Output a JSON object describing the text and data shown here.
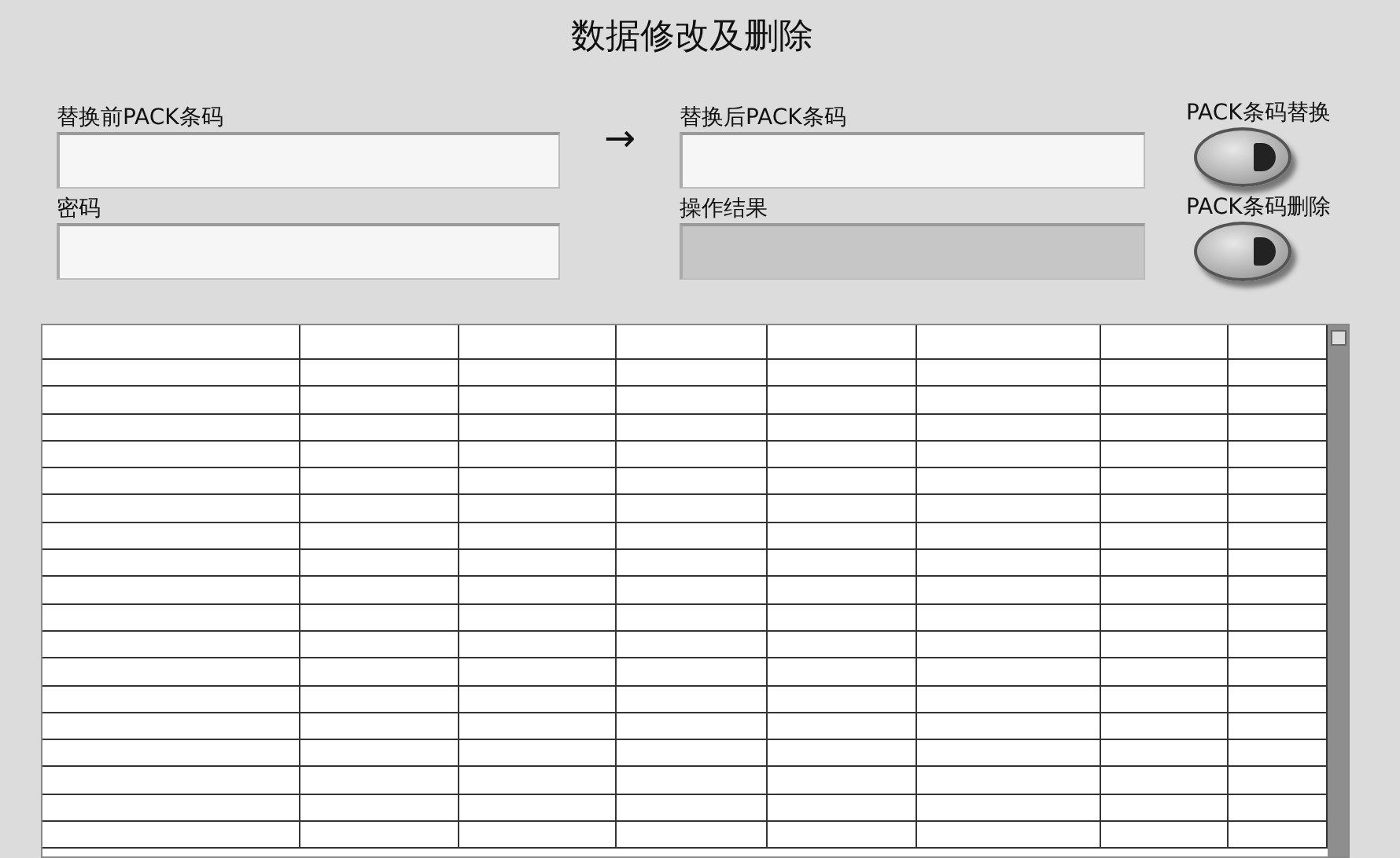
{
  "window": {
    "title": "数据修改及删除"
  },
  "fields": [
    {
      "label": "替换前PACK条码",
      "kind": "input"
    },
    {
      "label": "密码",
      "kind": "input"
    },
    {
      "label": "替换后PACK条码",
      "kind": "input"
    },
    {
      "label": "操作结果",
      "kind": "indicator"
    }
  ],
  "arrow": "→",
  "buttons": [
    {
      "label": "PACK条码替换",
      "on": false
    },
    {
      "label": "PACK条码删除",
      "on": false
    }
  ]
}
